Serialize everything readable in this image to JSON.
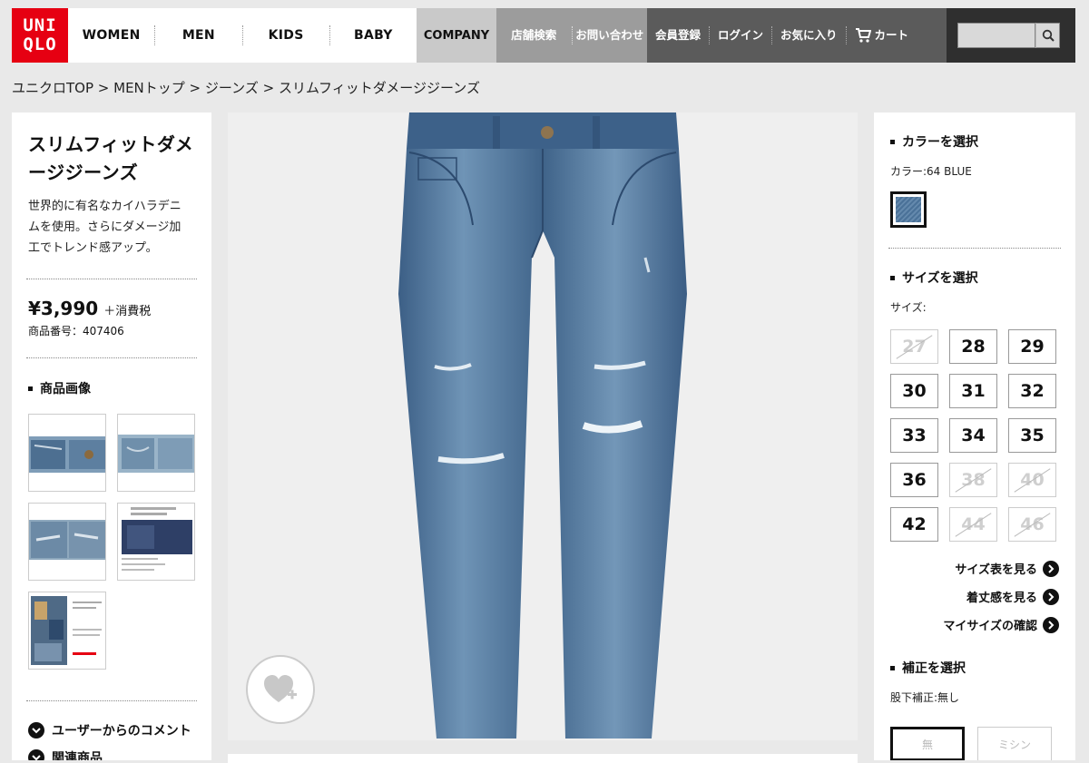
{
  "logo": {
    "line1": "UNI",
    "line2": "QLO"
  },
  "nav": {
    "main": [
      "WOMEN",
      "MEN",
      "KIDS",
      "BABY"
    ],
    "company": "COMPANY",
    "store": [
      "店舗検索",
      "お問い合わせ"
    ],
    "user": [
      "会員登録",
      "ログイン",
      "お気に入り"
    ],
    "cart": "カート"
  },
  "search": {
    "placeholder": ""
  },
  "breadcrumb": [
    "ユニクロTOP",
    "MENトップ",
    "ジーンズ",
    "スリムフィットダメージジーンズ"
  ],
  "breadcrumb_sep": " > ",
  "product": {
    "title_line1": "スリムフィットダメ",
    "title_line2": "ージジーンズ",
    "desc_line1": "世界的に有名なカイハラデニ",
    "desc_line2": "ムを使用。さらにダメージ加",
    "desc_line3": "工でトレンド感アップ。",
    "price": "¥3,990",
    "tax": "＋消費税",
    "number": "商品番号：407406"
  },
  "images_section": {
    "title": "商品画像"
  },
  "comments": {
    "label": "ユーザーからのコメント"
  },
  "related": {
    "label": "関連商品"
  },
  "color": {
    "title": "カラーを選択",
    "selected": "カラー:64 BLUE",
    "swatch_color": "#4a7198"
  },
  "size": {
    "title": "サイズを選択",
    "label": "サイズ:",
    "options": [
      {
        "label": "27",
        "available": false
      },
      {
        "label": "28",
        "available": true
      },
      {
        "label": "29",
        "available": true
      },
      {
        "label": "30",
        "available": true
      },
      {
        "label": "31",
        "available": true
      },
      {
        "label": "32",
        "available": true
      },
      {
        "label": "33",
        "available": true
      },
      {
        "label": "34",
        "available": true
      },
      {
        "label": "35",
        "available": true
      },
      {
        "label": "36",
        "available": true
      },
      {
        "label": "38",
        "available": false
      },
      {
        "label": "40",
        "available": false
      },
      {
        "label": "42",
        "available": true
      },
      {
        "label": "44",
        "available": false
      },
      {
        "label": "46",
        "available": false
      }
    ]
  },
  "links": {
    "size_chart": "サイズ表を見る",
    "fit": "着丈感を見る",
    "my_size": "マイサイズの確認"
  },
  "hem": {
    "title": "補正を選択",
    "status": "股下補正:無し",
    "opt_none": "無",
    "opt_mishin": "ミシン"
  },
  "colors": {
    "brand_red": "#e60012",
    "denim": "#4a6f92"
  }
}
